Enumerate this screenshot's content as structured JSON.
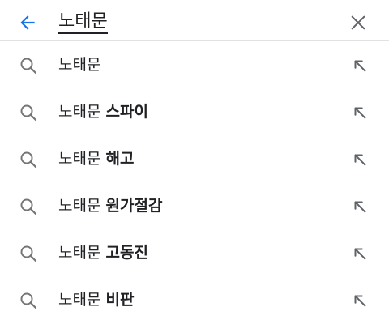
{
  "search": {
    "query": "노태문",
    "back_icon": "arrow-back-icon",
    "clear_icon": "close-icon",
    "accent_color": "#1a73e8"
  },
  "suggestions": [
    {
      "prefix": "노태문",
      "suffix": ""
    },
    {
      "prefix": "노태문",
      "suffix": "스파이"
    },
    {
      "prefix": "노태문",
      "suffix": "해고"
    },
    {
      "prefix": "노태문",
      "suffix": "원가절감"
    },
    {
      "prefix": "노태문",
      "suffix": "고동진"
    },
    {
      "prefix": "노태문",
      "suffix": "비판"
    }
  ]
}
